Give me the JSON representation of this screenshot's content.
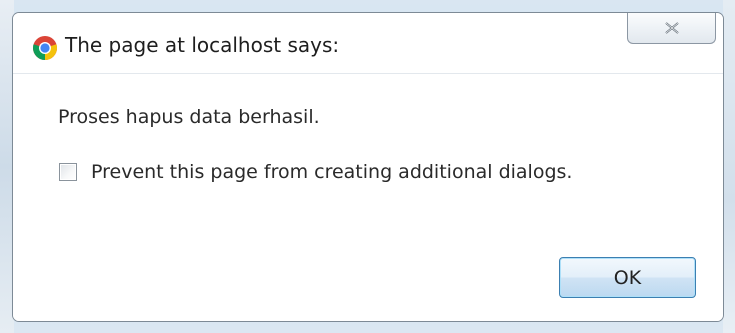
{
  "dialog": {
    "title": "The page at localhost says:",
    "close_glyph": "×",
    "message": "Proses hapus data berhasil.",
    "checkbox_label": "Prevent this page from creating additional dialogs.",
    "checkbox_checked": false,
    "ok_label": "OK"
  },
  "icons": {
    "title": "chrome-logo-icon",
    "close": "close-icon"
  },
  "colors": {
    "ok_border": "#3c7fb1",
    "ok_fill": "#cfe3f4",
    "dialog_border": "#7d8a96"
  }
}
